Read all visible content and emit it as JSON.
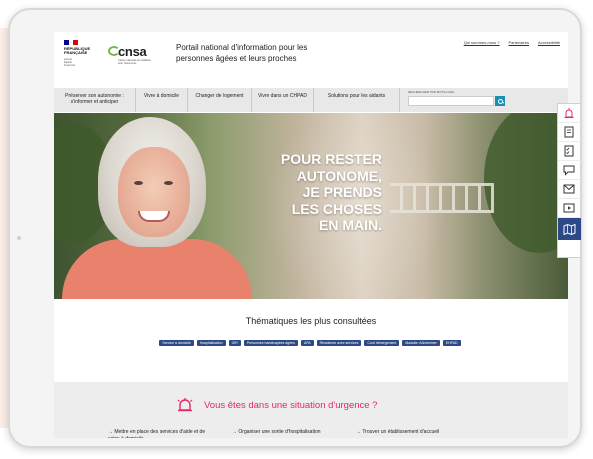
{
  "header": {
    "gov_logo_lines": [
      "RÉPUBLIQUE",
      "FRANÇAISE"
    ],
    "gov_logo_motto": [
      "Liberté",
      "Égalité",
      "Fraternité"
    ],
    "cnsa_name": "cnsa",
    "cnsa_subtitle": "Caisse nationale de solidarité pour l'autonomie",
    "portal_title": "Portail national d'information pour les personnes âgées et leurs proches",
    "top_links": [
      "Qui sommes-nous ?",
      "Partenaires",
      "Accessibilité"
    ]
  },
  "nav": {
    "items": [
      "Préserver son autonomie : s'informer et anticiper",
      "Vivre à domicile",
      "Changer de logement",
      "Vivre dans un CHPAD",
      "Solutions pour les aidants"
    ],
    "search_label": "RECHERCHER PAR MOTS-CLÉS",
    "search_placeholder": ""
  },
  "hero": {
    "lines": [
      "POUR RESTER",
      "AUTONOME,",
      "JE PRENDS",
      "LES CHOSES",
      "EN MAIN."
    ]
  },
  "themes": {
    "title": "Thématiques les plus consultées",
    "tags": [
      "Service à domicile",
      "Hospitalisation",
      "GIR",
      "Personnes handicapées âgées",
      "APA",
      "Résidence avec services",
      "Coût hébergement",
      "Maladie d'Alzheimer",
      "EHPAD"
    ]
  },
  "urgence": {
    "title": "Vous êtes dans une situation d'urgence ?",
    "links": [
      "Mettre en place des services d'aide et de soins à domicile",
      "Organiser une sortie d'hospitalisation",
      "Trouver un établissement d'accueil"
    ]
  },
  "toolbar": {
    "icons": [
      "alert-icon",
      "document-icon",
      "checklist-icon",
      "chat-icon",
      "mail-icon",
      "video-icon",
      "map-icon"
    ]
  },
  "colors": {
    "accent_pink": "#e8246a",
    "navy": "#2d4a86",
    "search_blue": "#1a8fb4",
    "cnsa_green": "#7ab648"
  }
}
